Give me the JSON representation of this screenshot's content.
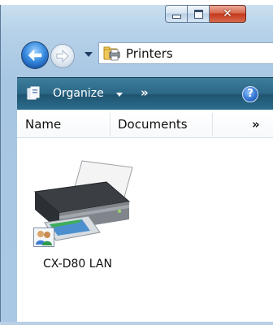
{
  "window": {
    "caption_buttons": {
      "minimize_icon": "minimize-icon",
      "maximize_icon": "maximize-icon",
      "close_icon": "close-icon",
      "close_glyph": "✕"
    }
  },
  "navigation": {
    "back_icon": "back-arrow-icon",
    "forward_icon": "forward-arrow-icon",
    "recent_pages_icon": "chevron-down-icon"
  },
  "address_bar": {
    "icon": "printers-folder-icon",
    "location": "Printers"
  },
  "toolbar": {
    "organize_label": "Organize",
    "overflow_chevron": "»",
    "help_glyph": "?"
  },
  "columns": [
    {
      "label": "Name"
    },
    {
      "label": "Documents"
    },
    {
      "label": "»"
    }
  ],
  "items": [
    {
      "label": "CX-D80 LAN",
      "icon": "printer-icon",
      "badge_icon": "shared-users-icon"
    }
  ],
  "colors": {
    "toolbar": "#2b6786",
    "frame": "#b6d1e8",
    "close_button": "#c7381b"
  }
}
